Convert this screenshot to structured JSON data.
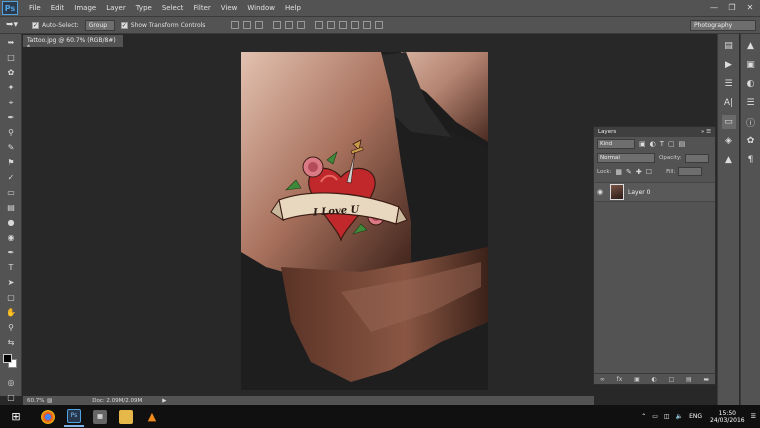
{
  "menu": {
    "logo": "Ps",
    "items": [
      "File",
      "Edit",
      "Image",
      "Layer",
      "Type",
      "Select",
      "Filter",
      "View",
      "Window",
      "Help"
    ]
  },
  "options": {
    "auto_select_label": "Auto-Select:",
    "group_select": "Group",
    "show_transform_label": "Show Transform Controls",
    "workspace": "Photography"
  },
  "document": {
    "tab_title": "Tattoo.jpg @ 60.7% (RGB/8#) *",
    "zoom": "60.7%",
    "doc_size": "Doc: 2.09M/2.09M"
  },
  "tattoo": {
    "banner_text": "I Love U"
  },
  "layers_panel": {
    "title": "Layers",
    "filter_kind": "Kind",
    "blend_mode": "Normal",
    "opacity_label": "Opacity:",
    "lock_label": "Lock:",
    "fill_label": "Fill:",
    "layers": [
      {
        "name": "Layer 0"
      }
    ]
  },
  "taskbar": {
    "language": "ENG",
    "time": "15:50",
    "date": "24/03/2016"
  }
}
